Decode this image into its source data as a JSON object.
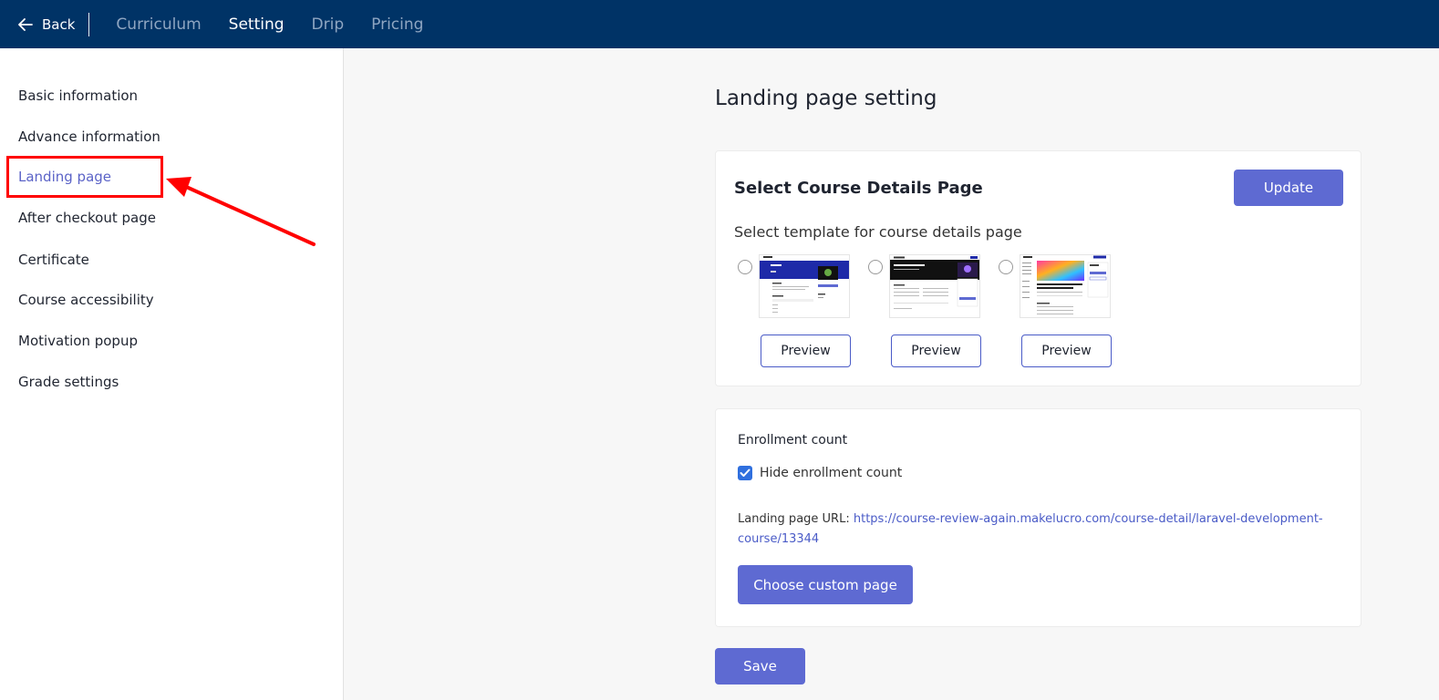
{
  "topbar": {
    "back_label": "Back",
    "tabs": [
      {
        "label": "Curriculum",
        "active": false
      },
      {
        "label": "Setting",
        "active": true
      },
      {
        "label": "Drip",
        "active": false
      },
      {
        "label": "Pricing",
        "active": false
      }
    ]
  },
  "sidebar": {
    "items": [
      {
        "label": "Basic information"
      },
      {
        "label": "Advance information"
      },
      {
        "label": "Landing page"
      },
      {
        "label": "After checkout page"
      },
      {
        "label": "Certificate"
      },
      {
        "label": "Course accessibility"
      },
      {
        "label": "Motivation popup"
      },
      {
        "label": "Grade settings"
      }
    ],
    "active_index": 2
  },
  "main": {
    "title": "Landing page setting",
    "course_details": {
      "title": "Select Course Details Page",
      "update_label": "Update",
      "subtitle": "Select template for course details page",
      "preview_label": "Preview"
    },
    "enrollment": {
      "title": "Enrollment count",
      "hide_label": "Hide enrollment count",
      "url_label": "Landing page URL:",
      "url_value": "https://course-review-again.makelucro.com/course-detail/laravel-development-course/13344",
      "custom_page_label": "Choose custom page"
    },
    "save_label": "Save"
  },
  "colors": {
    "topbar": "#003366",
    "accent": "#5e6ad2",
    "highlight": "#ff0000",
    "link": "#4a5bc7"
  }
}
